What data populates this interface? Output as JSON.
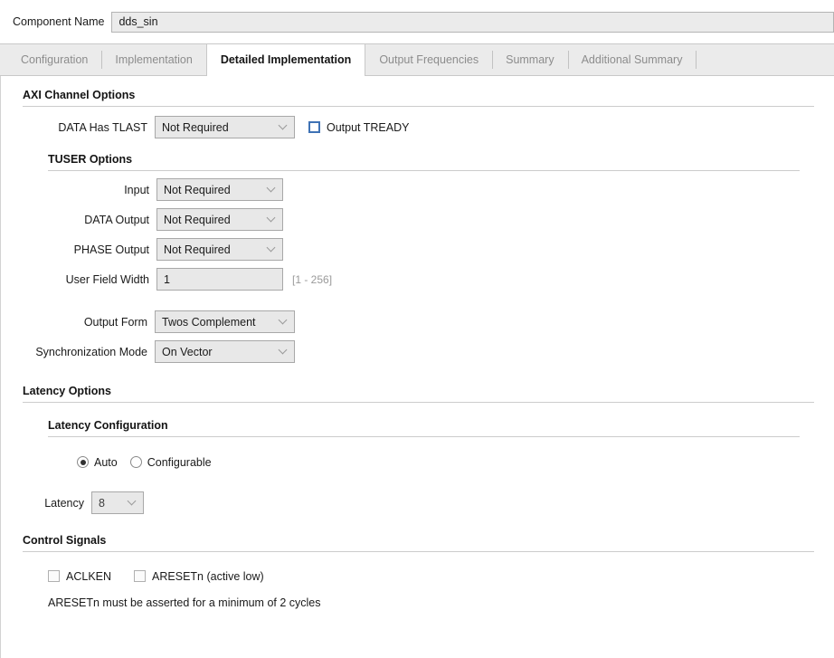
{
  "header": {
    "component_name_label": "Component Name",
    "component_name_value": "dds_sin"
  },
  "tabs": [
    {
      "label": "Configuration",
      "active": false
    },
    {
      "label": "Implementation",
      "active": false
    },
    {
      "label": "Detailed Implementation",
      "active": true
    },
    {
      "label": "Output Frequencies",
      "active": false
    },
    {
      "label": "Summary",
      "active": false
    },
    {
      "label": "Additional Summary",
      "active": false
    }
  ],
  "axi_channel_options": {
    "title": "AXI Channel Options",
    "data_has_tlast_label": "DATA Has TLAST",
    "data_has_tlast_value": "Not Required",
    "output_tready_label": "Output TREADY",
    "output_tready_checked": false
  },
  "tuser_options": {
    "title": "TUSER Options",
    "input_label": "Input",
    "input_value": "Not Required",
    "data_output_label": "DATA Output",
    "data_output_value": "Not Required",
    "phase_output_label": "PHASE Output",
    "phase_output_value": "Not Required",
    "user_field_width_label": "User Field Width",
    "user_field_width_value": "1",
    "user_field_width_range": "[1 - 256]"
  },
  "output_settings": {
    "output_form_label": "Output Form",
    "output_form_value": "Twos Complement",
    "sync_mode_label": "Synchronization Mode",
    "sync_mode_value": "On Vector"
  },
  "latency_options": {
    "title": "Latency Options",
    "config_title": "Latency Configuration",
    "auto_label": "Auto",
    "configurable_label": "Configurable",
    "selected": "Auto",
    "latency_label": "Latency",
    "latency_value": "8"
  },
  "control_signals": {
    "title": "Control Signals",
    "aclken_label": "ACLKEN",
    "aclken_checked": false,
    "aresetn_label": "ARESETn (active low)",
    "aresetn_checked": false,
    "note": "ARESETn must be asserted for a minimum of 2 cycles"
  },
  "colors": {
    "accent_checkbox_border": "#3f72b5",
    "tab_inactive_text": "#8c8c8c",
    "control_bg": "#e8e8e8"
  }
}
